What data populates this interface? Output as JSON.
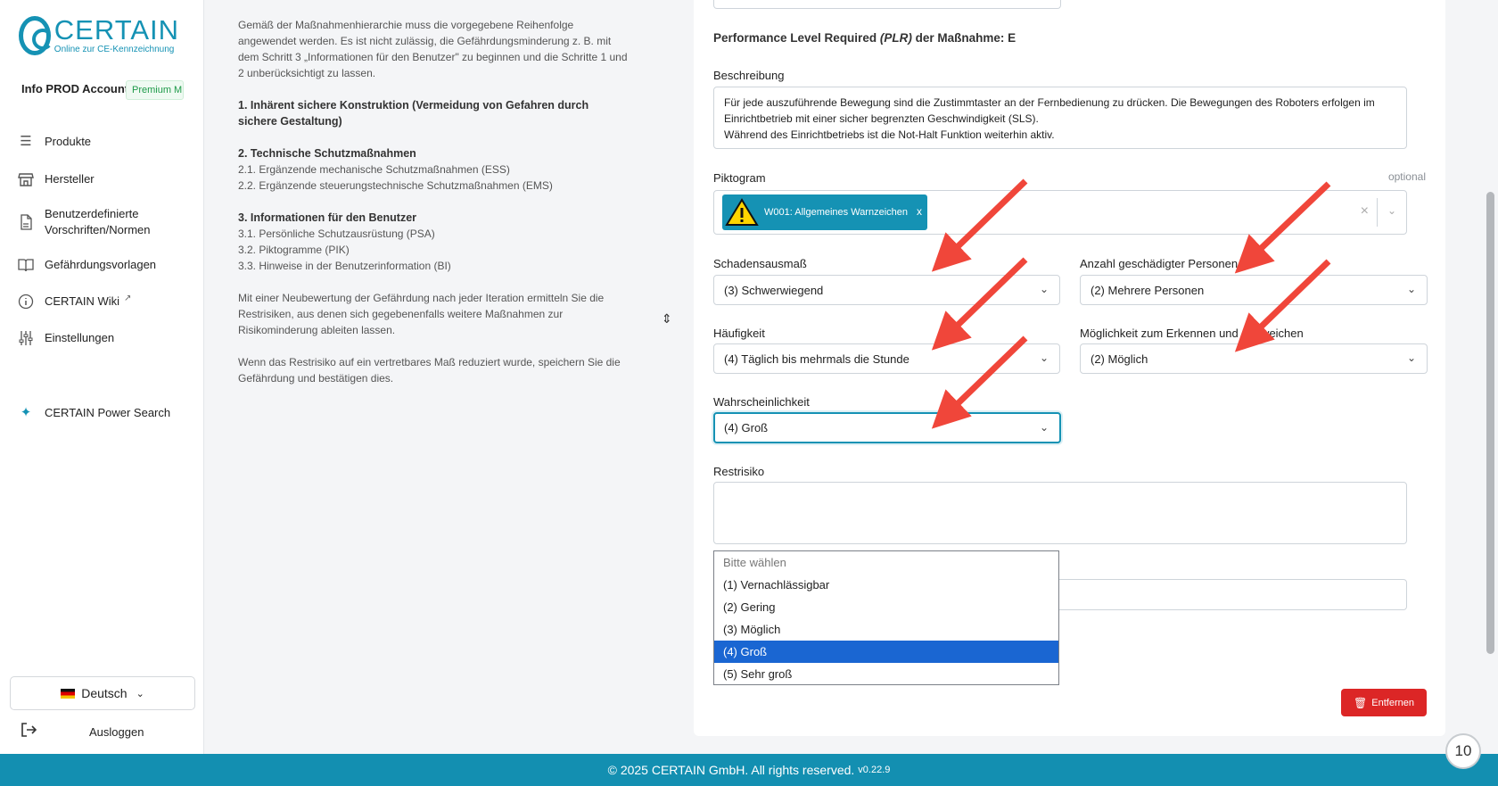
{
  "sidebar": {
    "logo_brand": "CERTAIN",
    "logo_sub": "Online zur CE-Kennzeichnung",
    "account_name": "Info PROD Account",
    "plan_badge": "Premium M",
    "items": [
      {
        "label": "Produkte",
        "icon": "list-icon"
      },
      {
        "label": "Hersteller",
        "icon": "store-icon"
      },
      {
        "label": "Benutzerdefinierte Vorschriften/Normen",
        "icon": "document-icon"
      },
      {
        "label": "Gefährdungsvorlagen",
        "icon": "book-icon"
      },
      {
        "label": "CERTAIN Wiki",
        "icon": "info-icon"
      },
      {
        "label": "Einstellungen",
        "icon": "sliders-icon"
      },
      {
        "label": "CERTAIN Power Search",
        "icon": "sparkles-icon"
      }
    ],
    "language": "Deutsch",
    "logout": "Ausloggen"
  },
  "guide": {
    "intro": "Gemäß der Maßnahmenhierarchie muss die vorgegebene Reihenfolge angewendet werden. Es ist nicht zulässig, die Gefährdungsminderung z. B. mit dem Schritt 3 „Informationen für den Benutzer\" zu beginnen und die Schritte 1 und 2 unberücksichtigt zu lassen.",
    "s1_title": "1. Inhärent sichere Konstruktion (Vermeidung von Gefahren durch sichere Gestaltung)",
    "s2_title": "2. Technische Schutzmaßnahmen",
    "s2_items": [
      "2.1. Ergänzende mechanische Schutzmaßnahmen (ESS)",
      "2.2. Ergänzende steuerungstechnische Schutzmaßnahmen (EMS)"
    ],
    "s3_title": "3. Informationen für den Benutzer",
    "s3_items": [
      "3.1. Persönliche Schutzausrüstung (PSA)",
      "3.2. Piktogramme (PIK)",
      "3.3. Hinweise in der Benutzerinformation (BI)"
    ],
    "para2": "Mit einer Neubewertung der Gefährdung nach jeder Iteration ermitteln Sie die Restrisiken, aus denen sich gegebenenfalls weitere Maßnahmen zur Risikominderung ableiten lassen.",
    "para3": "Wenn das Restrisiko auf ein vertretbares Maß reduziert wurde, speichern Sie die Gefährdung und bestätigen dies."
  },
  "form": {
    "plr_prefix": "Performance Level Required ",
    "plr_abbr": "(PLR)",
    "plr_suffix": " der Maßnahme: ",
    "plr_value": "E",
    "description_label": "Beschreibung",
    "description_value": "Für jede auszuführende Bewegung sind die Zustimmtaster an der Fernbedienung zu drücken. Die Bewegungen des Roboters erfolgen im Einrichtbetrieb mit einer sicher begrenzten Geschwindigkeit (SLS).\nWährend des Einrichtbetriebs ist die Not-Halt Funktion weiterhin aktiv.",
    "pictogram_label": "Piktogram",
    "optional_label": "optional",
    "pictogram_chip": "W001: Allgemeines Warnzeichen",
    "damage_label": "Schadensausmaß",
    "damage_value": "(3) Schwerwiegend",
    "persons_label": "Anzahl geschädigter Personen",
    "persons_value": "(2) Mehrere Personen",
    "frequency_label": "Häufigkeit",
    "frequency_value": "(4) Täglich bis mehrmals die Stunde",
    "avoid_label": "Möglichkeit zum Erkennen und Ausweichen",
    "avoid_value": "(2) Möglich",
    "probability_label": "Wahrscheinlichkeit",
    "probability_value": "(4) Groß",
    "residual_label": "Restrisiko",
    "remove_button": "Entfernen"
  },
  "dropdown": {
    "placeholder": "Bitte wählen",
    "options": [
      "(1) Vernachlässigbar",
      "(2) Gering",
      "(3) Möglich",
      "(4) Groß",
      "(5) Sehr groß"
    ],
    "selected": "(4) Groß"
  },
  "footer": {
    "copyright": "© 2025 CERTAIN GmbH. All rights reserved.",
    "version": "v0.22.9"
  },
  "page_badge": "10",
  "colors": {
    "brand": "#1592b4",
    "danger": "#dc2626",
    "selected_option": "#1a66d2",
    "annotation_arrow": "#f0463a"
  }
}
